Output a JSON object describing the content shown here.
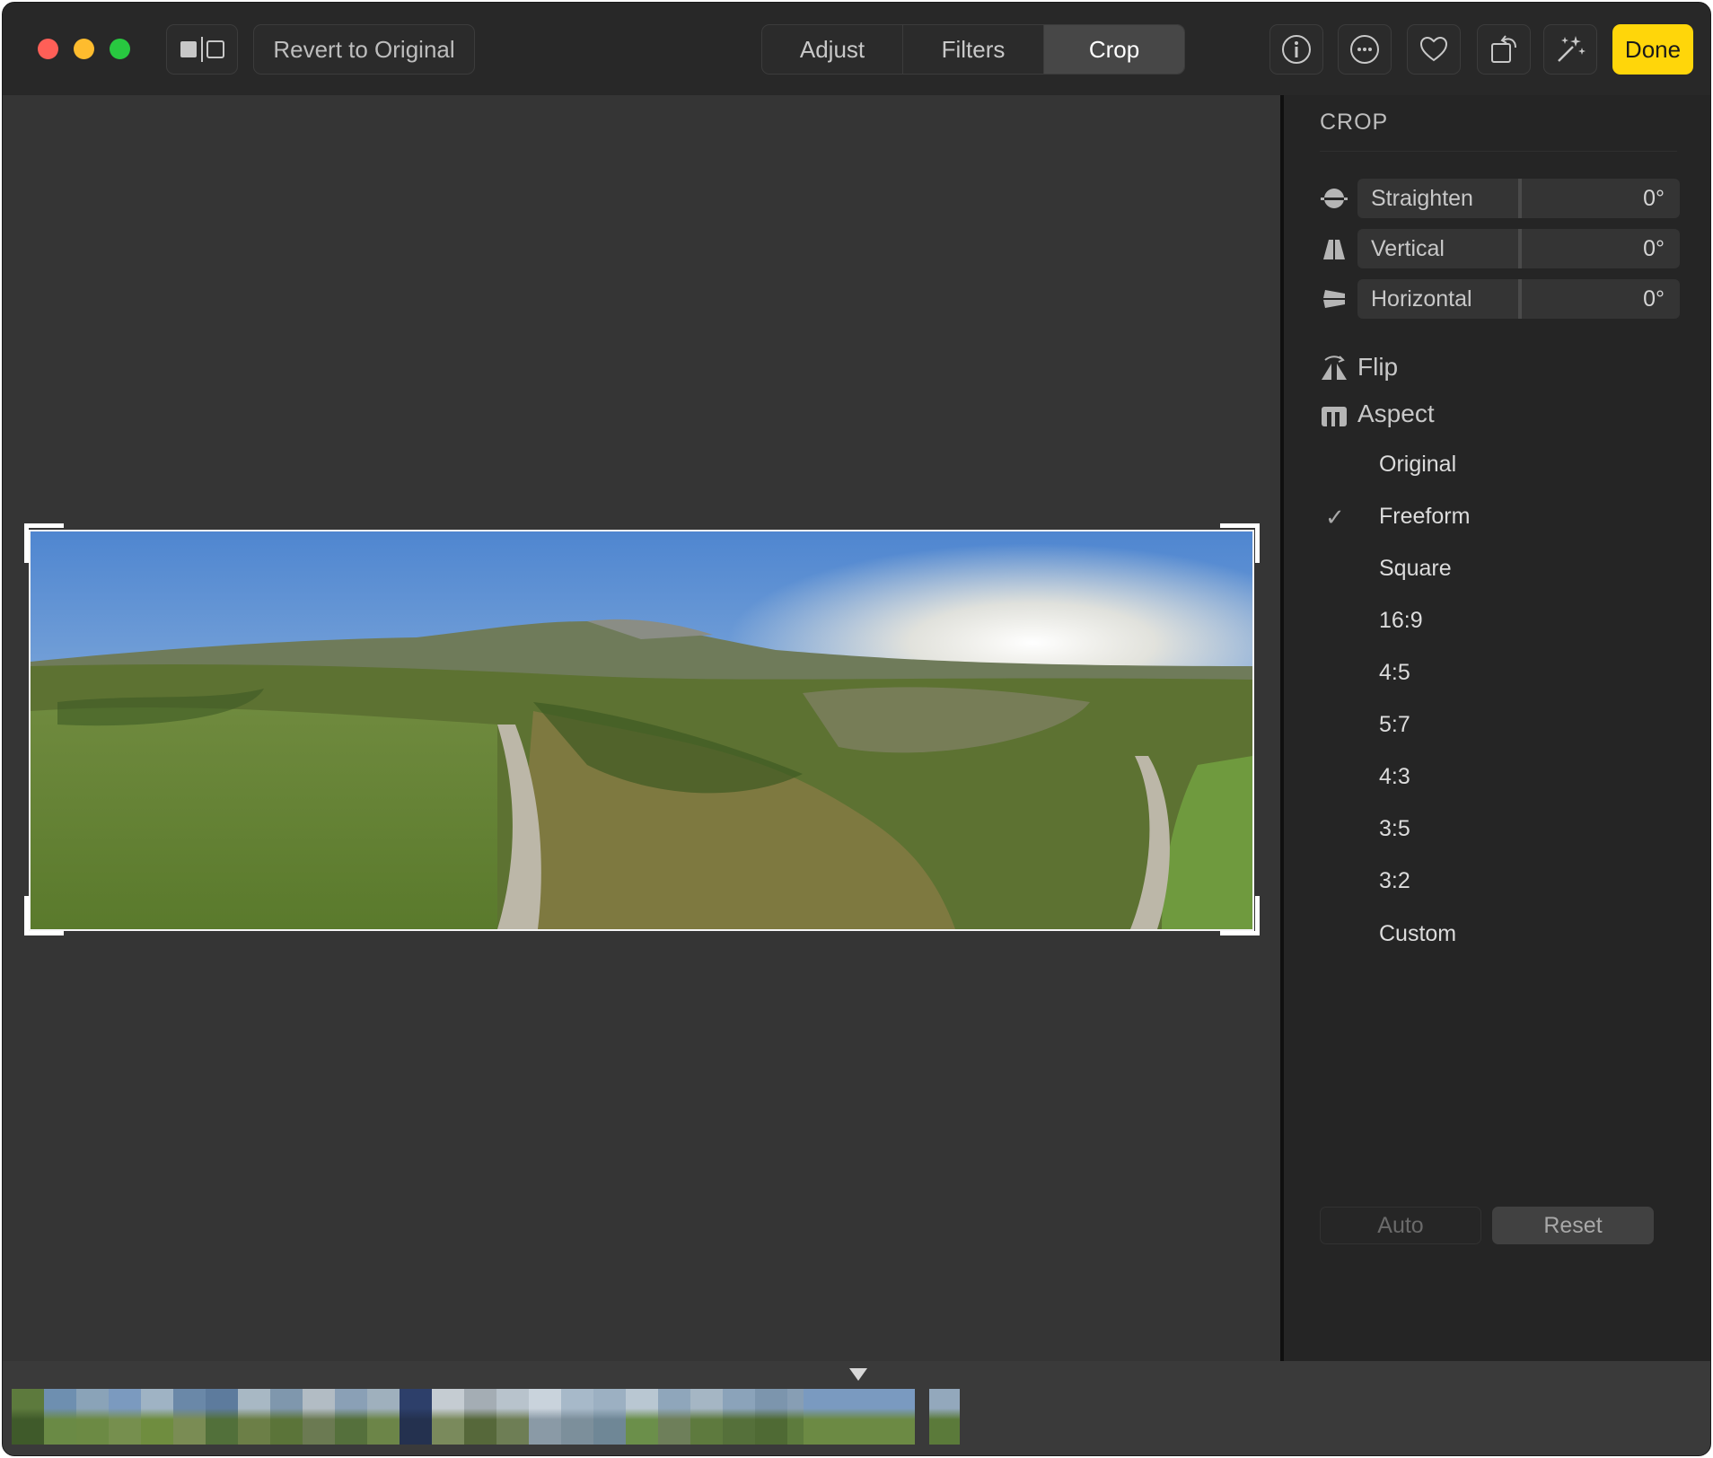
{
  "toolbar": {
    "revert_label": "Revert to Original",
    "tabs": [
      {
        "label": "Adjust",
        "active": false
      },
      {
        "label": "Filters",
        "active": false
      },
      {
        "label": "Crop",
        "active": true
      }
    ],
    "done_label": "Done",
    "icons": [
      "compare-icon",
      "info-icon",
      "more-icon",
      "heart-icon",
      "rotate-icon",
      "magic-wand-icon"
    ],
    "accent_color": "#ffd60a"
  },
  "sidebar": {
    "title": "CROP",
    "sliders": [
      {
        "label": "Straighten",
        "value": "0°",
        "icon": "straighten-icon"
      },
      {
        "label": "Vertical",
        "value": "0°",
        "icon": "vertical-perspective-icon"
      },
      {
        "label": "Horizontal",
        "value": "0°",
        "icon": "horizontal-perspective-icon"
      }
    ],
    "flip_label": "Flip",
    "aspect_label": "Aspect",
    "aspect_options": [
      {
        "label": "Original",
        "selected": false
      },
      {
        "label": "Freeform",
        "selected": true
      },
      {
        "label": "Square",
        "selected": false
      },
      {
        "label": "16:9",
        "selected": false
      },
      {
        "label": "4:5",
        "selected": false
      },
      {
        "label": "5:7",
        "selected": false
      },
      {
        "label": "4:3",
        "selected": false
      },
      {
        "label": "3:5",
        "selected": false
      },
      {
        "label": "3:2",
        "selected": false
      },
      {
        "label": "Custom",
        "selected": false
      }
    ],
    "check_mark": "✓",
    "auto_label": "Auto",
    "reset_label": "Reset"
  },
  "filmstrip": {
    "thumbnail_count": 28,
    "selected_index": 25
  }
}
